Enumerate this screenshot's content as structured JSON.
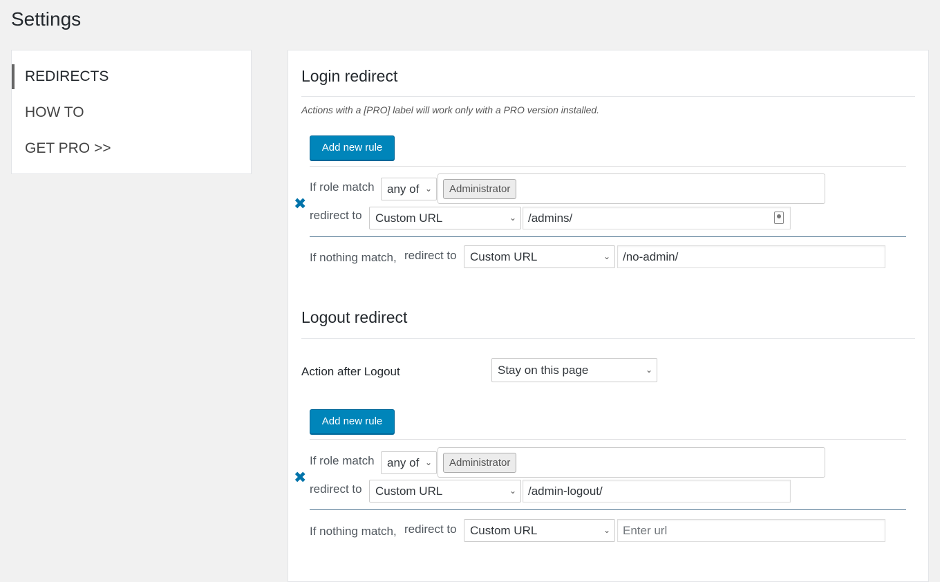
{
  "page": {
    "title": "Settings"
  },
  "sidebar": {
    "items": [
      {
        "label": "REDIRECTS",
        "active": true
      },
      {
        "label": "HOW TO",
        "active": false
      },
      {
        "label": "GET PRO >>",
        "active": false
      }
    ]
  },
  "login": {
    "title": "Login redirect",
    "note": "Actions with a [PRO] label will work only with a PRO version installed.",
    "add_rule_label": "Add new rule",
    "rule": {
      "role_label": "If role match",
      "match_mode": "any of",
      "roles": [
        "Administrator"
      ],
      "redirect_label": "redirect to",
      "redirect_type": "Custom URL",
      "url": "/admins/"
    },
    "fallback": {
      "label_a": "If nothing match,",
      "label_b": "redirect to",
      "redirect_type": "Custom URL",
      "url": "/no-admin/"
    }
  },
  "logout": {
    "title": "Logout redirect",
    "action_label": "Action after Logout",
    "action_value": "Stay on this page",
    "add_rule_label": "Add new rule",
    "rule": {
      "role_label": "If role match",
      "match_mode": "any of",
      "roles": [
        "Administrator"
      ],
      "redirect_label": "redirect to",
      "redirect_type": "Custom URL",
      "url": "/admin-logout/"
    },
    "fallback": {
      "label_a": "If nothing match,",
      "label_b": "redirect to",
      "redirect_type": "Custom URL",
      "url": "",
      "url_placeholder": "Enter url"
    }
  },
  "colors": {
    "primary_button": "#0085ba",
    "remove_icon": "#0073aa",
    "background": "#f1f1f1"
  }
}
